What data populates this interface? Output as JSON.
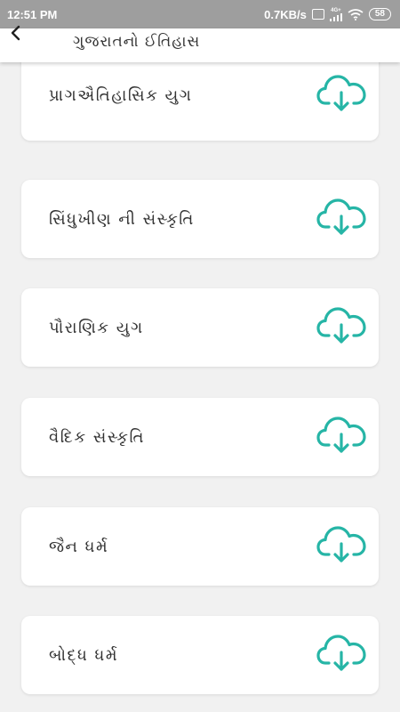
{
  "status_bar": {
    "time": "12:51 PM",
    "speed": "0.7KB/s",
    "network_badge": "4G+",
    "battery": "58"
  },
  "app_bar": {
    "title": "ગુજરાતનો ઈતિહાસ",
    "back_icon": "chevron-left-icon"
  },
  "items": [
    {
      "label": "પ્રાગઐતિહાસિક યુગ",
      "icon": "cloud-download-icon"
    },
    {
      "label": "સિંધુખીણ ની સંસ્કૃતિ",
      "icon": "cloud-download-icon"
    },
    {
      "label": "પૌરાણિક યુગ",
      "icon": "cloud-download-icon"
    },
    {
      "label": "વૈદિક સંસ્કૃતિ",
      "icon": "cloud-download-icon"
    },
    {
      "label": "જૈન ધર્મ",
      "icon": "cloud-download-icon"
    },
    {
      "label": "બોદ્ધ ધર્મ",
      "icon": "cloud-download-icon"
    }
  ],
  "colors": {
    "accent": "#26b5a6",
    "status_bar": "#9e9e9e",
    "background": "#f1f1f1"
  }
}
